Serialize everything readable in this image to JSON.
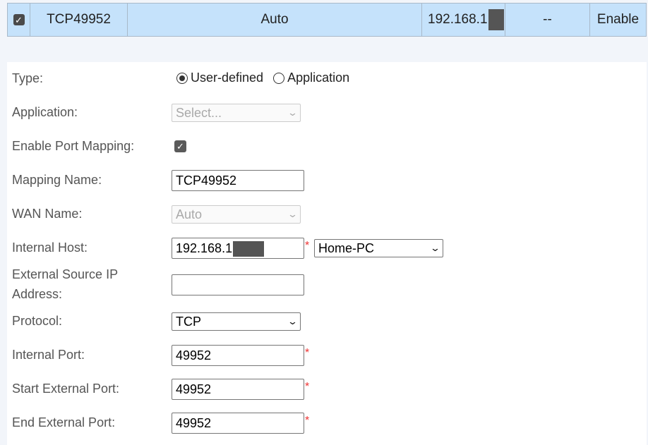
{
  "table_row": {
    "checked": true,
    "name": "TCP49952",
    "wan_name": "Auto",
    "internal_host": "192.168.1.",
    "external_source": "--",
    "status": "Enable"
  },
  "form": {
    "type": {
      "label": "Type:",
      "options": [
        "User-defined",
        "Application"
      ],
      "selected": "User-defined"
    },
    "application": {
      "label": "Application:",
      "value": "Select..."
    },
    "enable_port_mapping": {
      "label": "Enable Port Mapping:",
      "checked": true
    },
    "mapping_name": {
      "label": "Mapping Name:",
      "value": "TCP49952"
    },
    "wan_name": {
      "label": "WAN Name:",
      "value": "Auto"
    },
    "internal_host": {
      "label": "Internal Host:",
      "value": "192.168.1",
      "device": "Home-PC"
    },
    "external_source_ip": {
      "label_line1": "External Source IP",
      "label_line2": "Address:",
      "value": ""
    },
    "protocol": {
      "label": "Protocol:",
      "value": "TCP"
    },
    "internal_port": {
      "label": "Internal Port:",
      "value": "49952"
    },
    "start_external_port": {
      "label": "Start External Port:",
      "value": "49952"
    },
    "end_external_port": {
      "label": "End External Port:",
      "value": "49952"
    },
    "required_mark": "*"
  },
  "icons": {
    "check": "check-icon",
    "dropdown": "chevron-down-icon"
  },
  "colors": {
    "row_highlight": "#c5e2fb",
    "required": "#e33333",
    "panel_bg": "#ffffff",
    "page_bg": "#f2f5fa"
  }
}
